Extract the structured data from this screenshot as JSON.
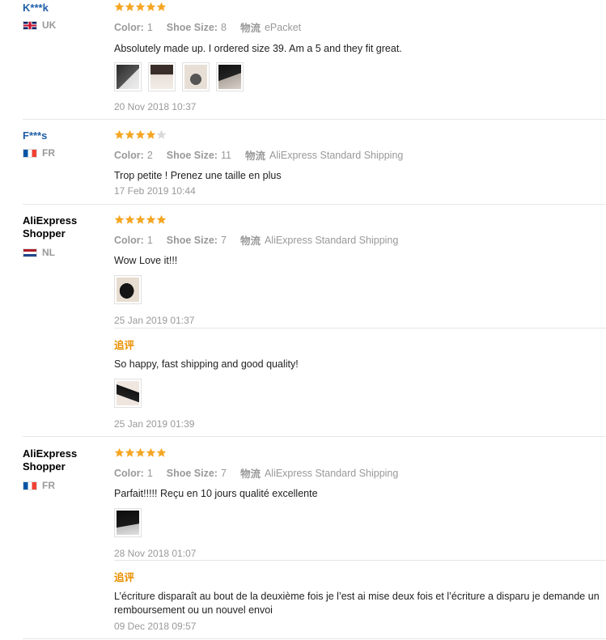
{
  "labels": {
    "color": "Color:",
    "shoe_size": "Shoe Size:",
    "shipping": "物流",
    "followup": "追评"
  },
  "reviews": [
    {
      "name": "K***k",
      "country": "UK",
      "rating": 5,
      "color": "1",
      "size": "8",
      "shipping": "ePacket",
      "text": "Absolutely made up. I ordered size 39. Am a 5 and they fit great.",
      "date": "20 Nov 2018 10:37"
    },
    {
      "name": "F***s",
      "country": "FR",
      "rating": 4,
      "color": "2",
      "size": "11",
      "shipping": "AliExpress Standard Shipping",
      "text": "Trop petite ! Prenez une taille en plus",
      "date": "17 Feb 2019 10:44"
    },
    {
      "name": "AliExpress Shopper",
      "country": "NL",
      "rating": 5,
      "color": "1",
      "size": "7",
      "shipping": "AliExpress Standard Shipping",
      "text": "Wow Love it!!!",
      "date": "25 Jan 2019 01:37",
      "followup_text": "So happy, fast shipping and good quality!",
      "followup_date": "25 Jan 2019 01:39"
    },
    {
      "name": "AliExpress Shopper",
      "country": "FR",
      "rating": 5,
      "color": "1",
      "size": "7",
      "shipping": "AliExpress Standard Shipping",
      "text": "Parfait!!!!! Reçu en 10 jours qualité excellente",
      "date": "28 Nov 2018 01:07",
      "followup_text": "L’écriture disparaît au bout de la deuxième fois je l’est ai mise deux fois et l’écriture a disparu je demande un remboursement ou un nouvel envoi",
      "followup_date": "09 Dec 2018 09:57"
    }
  ],
  "colors": {
    "star": "#f5a623",
    "star_empty": "#d9d9d9",
    "followup": "#e88f00"
  }
}
